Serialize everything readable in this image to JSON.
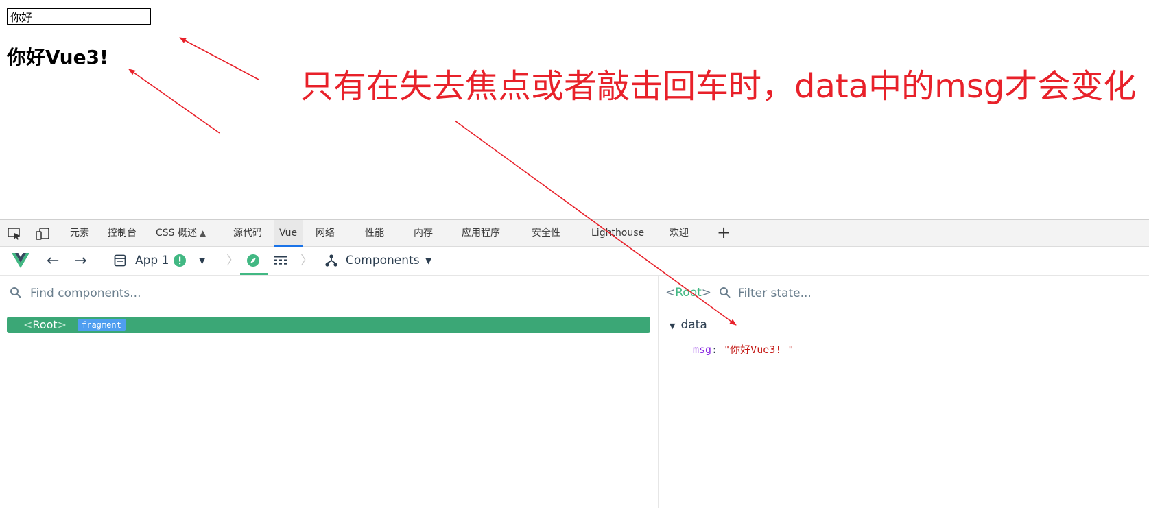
{
  "page": {
    "input_value": "你好",
    "heading": "你好Vue3!"
  },
  "annotation": {
    "text": "只有在失去焦点或者敲击回车时，data中的msg才会变化",
    "color": "#e8212a"
  },
  "devtools": {
    "tabs": [
      {
        "label": "元素"
      },
      {
        "label": "控制台"
      },
      {
        "label": "CSS 概述"
      },
      {
        "label": "源代码"
      },
      {
        "label": "Vue",
        "active": true
      },
      {
        "label": "网络"
      },
      {
        "label": "性能"
      },
      {
        "label": "内存"
      },
      {
        "label": "应用程序"
      },
      {
        "label": "安全性"
      },
      {
        "label": "Lighthouse"
      },
      {
        "label": "欢迎"
      }
    ],
    "add_tab": "+",
    "accent_color": "#1a73e8"
  },
  "vue_toolbar": {
    "app_label": "App 1",
    "view_label": "Components",
    "brand_color": "#42b883"
  },
  "components_pane": {
    "search_placeholder": "Find components...",
    "tree": [
      {
        "open": "<",
        "name": "Root",
        "close": ">",
        "badge": "fragment"
      }
    ]
  },
  "state_pane": {
    "root_open": "<",
    "root_name": "Root",
    "root_close": ">",
    "filter_placeholder": "Filter state...",
    "section": "data",
    "entries": [
      {
        "key": "msg",
        "colon": ":",
        "value": "\"你好Vue3! \""
      }
    ]
  }
}
